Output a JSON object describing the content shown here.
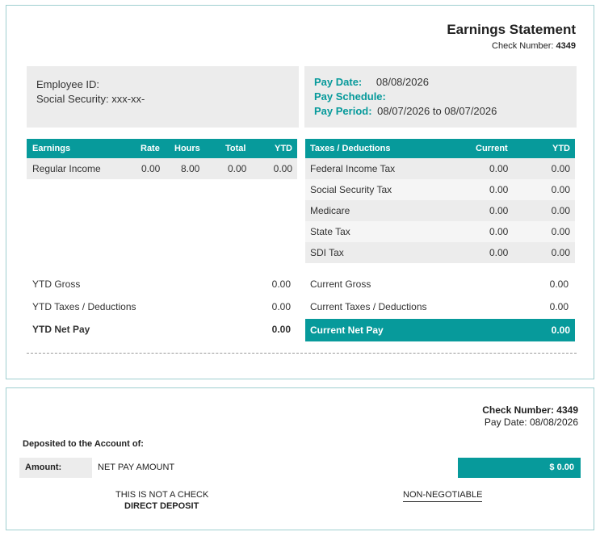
{
  "statement": {
    "title": "Earnings Statement",
    "check_label": "Check Number:",
    "check_number": "4349"
  },
  "employee": {
    "id_label": "Employee ID:",
    "ssn_label": "Social Security: xxx-xx-"
  },
  "pay_info": {
    "pay_date_label": "Pay Date:",
    "pay_date_value": "08/08/2026",
    "pay_schedule_label": "Pay Schedule:",
    "pay_period_label": "Pay Period:",
    "pay_period_value": "08/07/2026 to 08/07/2026"
  },
  "earnings": {
    "headers": [
      "Earnings",
      "Rate",
      "Hours",
      "Total",
      "YTD"
    ],
    "rows": [
      [
        "Regular Income",
        "0.00",
        "8.00",
        "0.00",
        "0.00"
      ]
    ]
  },
  "taxes": {
    "headers": [
      "Taxes / Deductions",
      "Current",
      "YTD"
    ],
    "rows": [
      [
        "Federal Income Tax",
        "0.00",
        "0.00"
      ],
      [
        "Social Security Tax",
        "0.00",
        "0.00"
      ],
      [
        "Medicare",
        "0.00",
        "0.00"
      ],
      [
        "State Tax",
        "0.00",
        "0.00"
      ],
      [
        "SDI Tax",
        "0.00",
        "0.00"
      ]
    ]
  },
  "ytd_summary": {
    "gross_label": "YTD Gross",
    "gross_value": "0.00",
    "taxes_label": "YTD Taxes / Deductions",
    "taxes_value": "0.00",
    "net_label": "YTD Net Pay",
    "net_value": "0.00"
  },
  "current_summary": {
    "gross_label": "Current Gross",
    "gross_value": "0.00",
    "taxes_label": "Current Taxes / Deductions",
    "taxes_value": "0.00",
    "net_label": "Current Net Pay",
    "net_value": "0.00"
  },
  "stub": {
    "check_label": "Check Number:",
    "check_number": "4349",
    "pay_date_label": "Pay Date:",
    "pay_date_value": "08/08/2026",
    "deposited_label": "Deposited to the Account of:",
    "amount_label": "Amount:",
    "amount_words": "NET PAY AMOUNT",
    "amount_value": "$ 0.00",
    "not_check": "THIS IS NOT A CHECK",
    "direct_deposit": "DIRECT DEPOSIT",
    "non_negotiable": "NON-NEGOTIABLE"
  },
  "colors": {
    "accent": "#079a9b",
    "panel_border": "#9fcfd0",
    "gray_fill": "#ececec"
  }
}
